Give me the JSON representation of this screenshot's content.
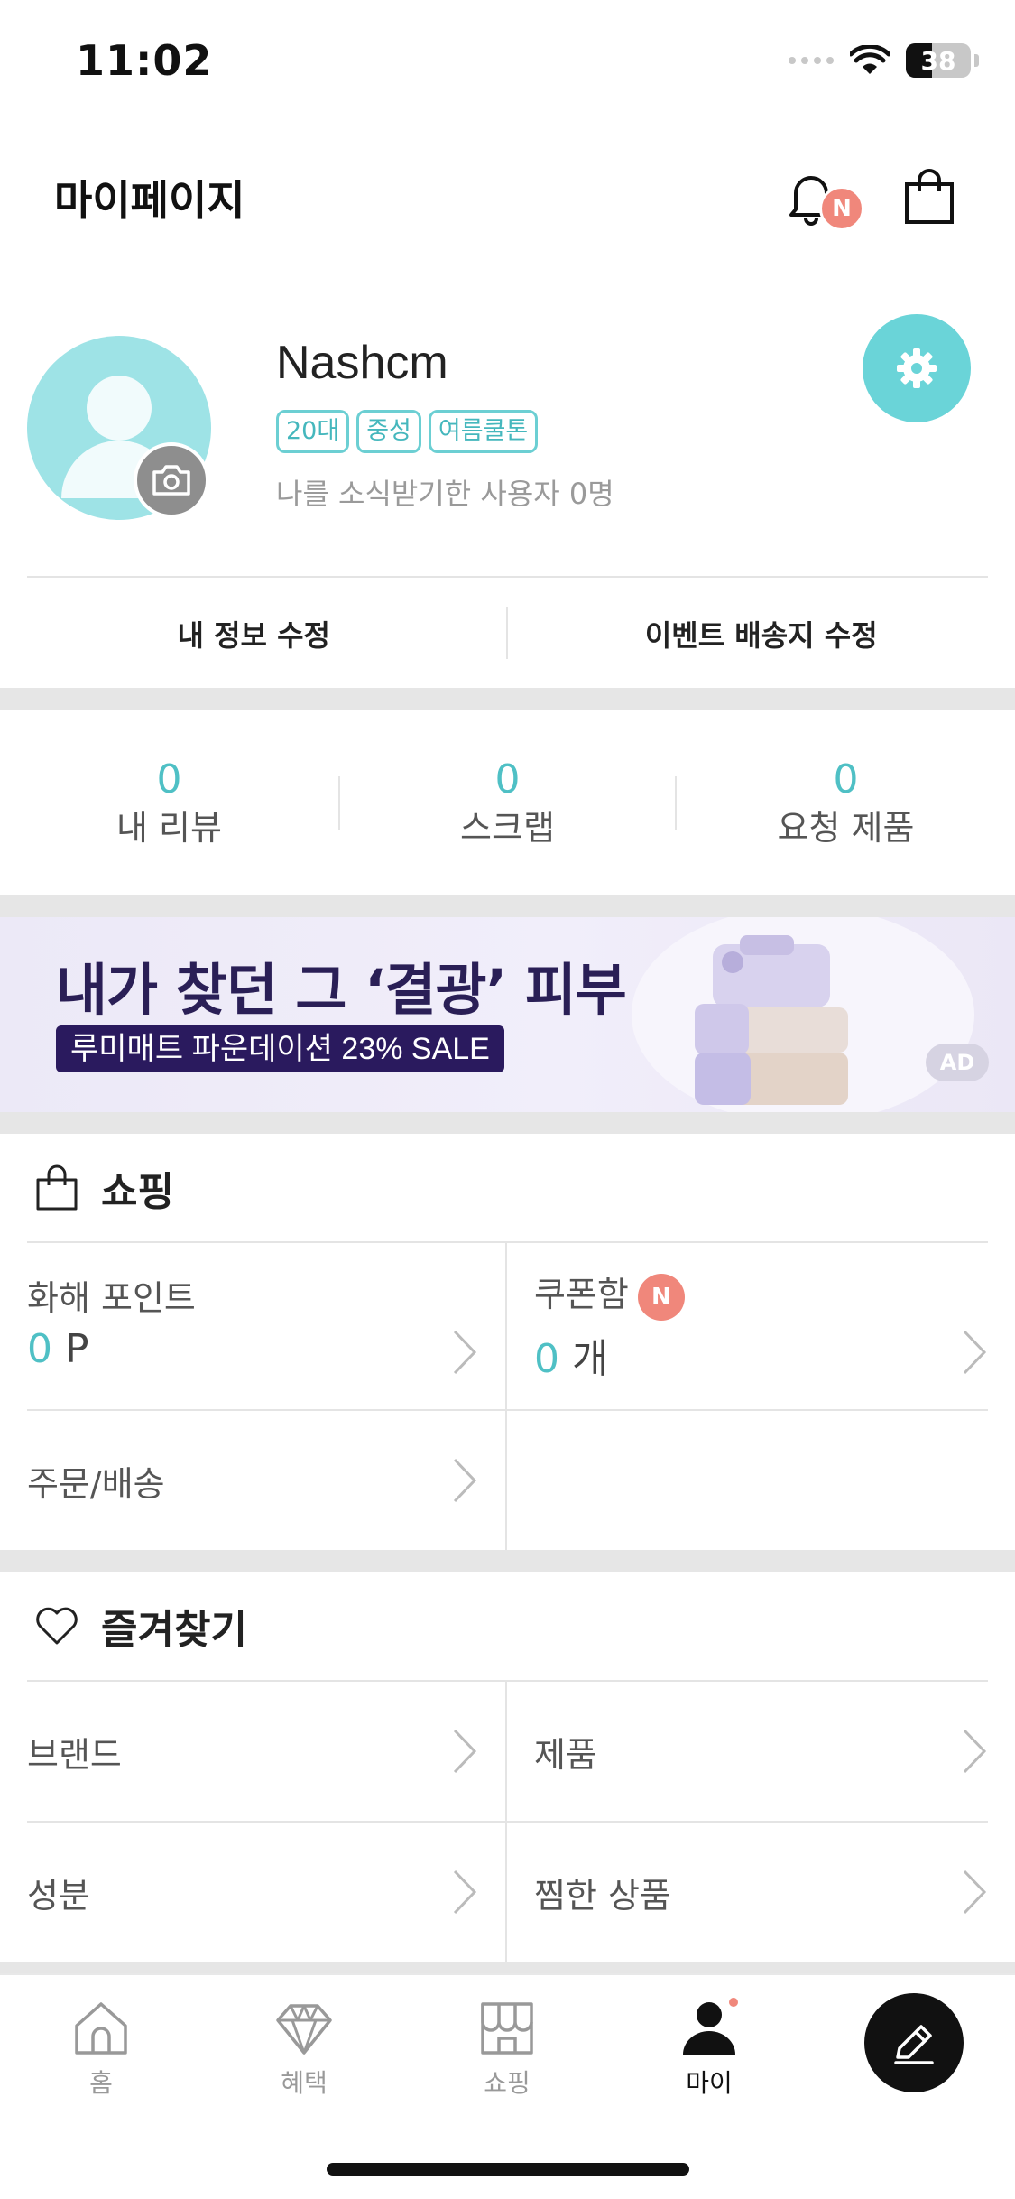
{
  "status_bar": {
    "time": "11:02",
    "battery": "38"
  },
  "header": {
    "title": "마이페이지",
    "notification_badge": "N"
  },
  "profile": {
    "username": "Nashcm",
    "tags": [
      "20대",
      "중성",
      "여름쿨톤"
    ],
    "followers_text": "나를 소식받기한 사용자 0명",
    "edit_info_label": "내 정보 수정",
    "edit_address_label": "이벤트 배송지 수정"
  },
  "stats": [
    {
      "value": "0",
      "label": "내 리뷰"
    },
    {
      "value": "0",
      "label": "스크랩"
    },
    {
      "value": "0",
      "label": "요청 제품"
    }
  ],
  "ad": {
    "title": "내가 찾던 그 ‘결광’ 피부",
    "subtitle": "루미매트 파운데이션 23% SALE",
    "badge": "AD"
  },
  "shopping": {
    "title": "쇼핑",
    "points_label": "화해 포인트",
    "points_value": "0",
    "points_unit": " P",
    "coupon_label": "쿠폰함",
    "coupon_badge": "N",
    "coupon_value": "0",
    "coupon_unit": " 개",
    "orders_label": "주문/배송"
  },
  "favorites": {
    "title": "즐겨찾기",
    "items": [
      "브랜드",
      "제품",
      "성분",
      "찜한 상품"
    ]
  },
  "tabbar": {
    "tabs": [
      {
        "label": "홈",
        "icon": "home-icon"
      },
      {
        "label": "혜택",
        "icon": "diamond-icon"
      },
      {
        "label": "쇼핑",
        "icon": "store-icon"
      },
      {
        "label": "마이",
        "icon": "person-icon"
      }
    ],
    "active": "마이"
  },
  "colors": {
    "accent": "#4fc0c5",
    "badge": "#f0877b",
    "ad_navy": "#2a1a5e"
  }
}
